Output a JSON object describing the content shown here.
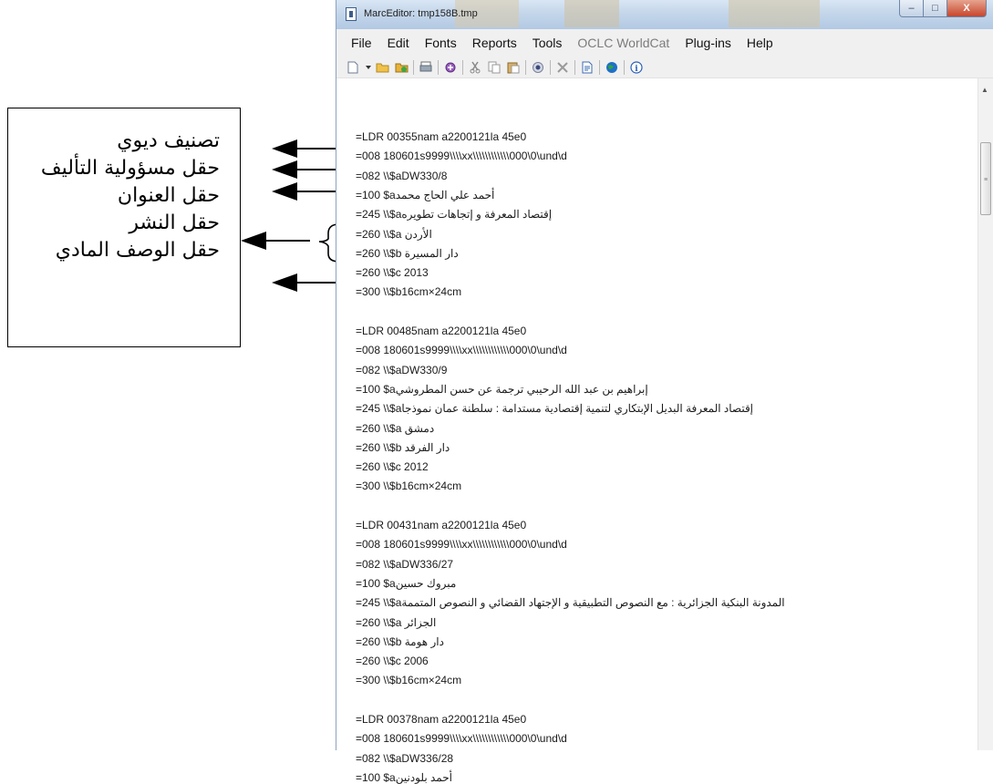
{
  "annotations": {
    "labels": [
      "تصنيف ديوي",
      "حقل مسؤولية التأليف",
      "حقل العنوان",
      "حقل النشر",
      "حقل الوصف المادي"
    ]
  },
  "window": {
    "title": "MarcEditor: tmp158B.tmp",
    "buttons": {
      "minimize": "–",
      "maximize": "□",
      "close": "X"
    }
  },
  "menu": [
    "File",
    "Edit",
    "Fonts",
    "Reports",
    "Tools",
    "OCLC WorldCat",
    "Plug-ins",
    "Help"
  ],
  "menu_dimmed": "OCLC WorldCat",
  "toolbar_icons": [
    "new-document-icon",
    "dropdown-arrow-icon",
    "open-folder-icon",
    "open-recent-icon",
    "print-icon",
    "compile-icon",
    "cut-icon",
    "copy-icon",
    "paste-icon",
    "validate-icon",
    "delete-icon",
    "find-icon",
    "globe-icon",
    "info-icon"
  ],
  "records": [
    {
      "lines": [
        "=LDR  00355nam a2200121la 45e0",
        "=008  180601s9999\\\\\\\\xx\\\\\\\\\\\\\\\\\\\\\\\\000\\0\\und\\d",
        "=082  \\\\$aDW330/8",
        "=100  $aأحمد علي الحاج محمد",
        "=245  \\\\$aإقتصاد المعرفة و إتجاهات تطويره",
        "=260  \\\\$a  الأردن",
        "=260  \\\\$b    دار المسيرة",
        "=260  \\\\$c  2013",
        "=300  \\\\$b16cm×24cm"
      ]
    },
    {
      "lines": [
        "=LDR  00485nam a2200121la 45e0",
        "=008  180601s9999\\\\\\\\xx\\\\\\\\\\\\\\\\\\\\\\\\000\\0\\und\\d",
        "=082  \\\\$aDW330/9",
        "=100  $aإبراهيم بن عبد الله الرحيبي   ترجمة عن حسن المطروشي",
        "=245  \\\\$aإقتصاد المعرفة البديل الإبتكاري لتنمية إقتصادية مستدامة : سلطنة عمان نموذجا",
        "=260  \\\\$a  دمشق",
        "=260  \\\\$b    دار الفرقد",
        "=260  \\\\$c  2012",
        "=300  \\\\$b16cm×24cm"
      ]
    },
    {
      "lines": [
        "=LDR  00431nam a2200121la 45e0",
        "=008  180601s9999\\\\\\\\xx\\\\\\\\\\\\\\\\\\\\\\\\000\\0\\und\\d",
        "=082  \\\\$aDW336/27",
        "=100  $aمبروك حسين",
        "=245  \\\\$aالمدونة البنكية الجزائرية  : مع النصوص التطبيقية و الإجتهاد القضائي و النصوص المتممة",
        "=260  \\\\$a الجزائر",
        "=260  \\\\$b    دار هومة",
        "=260  \\\\$c  2006",
        "=300  \\\\$b16cm×24cm"
      ]
    },
    {
      "lines": [
        "=LDR  00378nam a2200121la 45e0",
        "=008  180601s9999\\\\\\\\xx\\\\\\\\\\\\\\\\\\\\\\\\000\\0\\und\\d",
        "=082  \\\\$aDW336/28",
        "=100  $aأحمد بلودنين"
      ]
    }
  ]
}
